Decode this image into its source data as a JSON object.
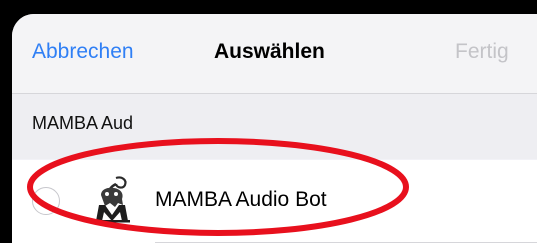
{
  "nav": {
    "cancel_label": "Abbrechen",
    "title": "Auswählen",
    "done_label": "Fertig"
  },
  "search": {
    "text": "MAMBA Aud"
  },
  "results": [
    {
      "label": "MAMBA Audio Bot",
      "selected": false,
      "avatar_icon": "mamba-logo-icon"
    }
  ],
  "colors": {
    "accent": "#2f7ff5",
    "disabled": "#c4c4c8",
    "annotation": "#e8101d",
    "background": "#f2f2f7"
  }
}
